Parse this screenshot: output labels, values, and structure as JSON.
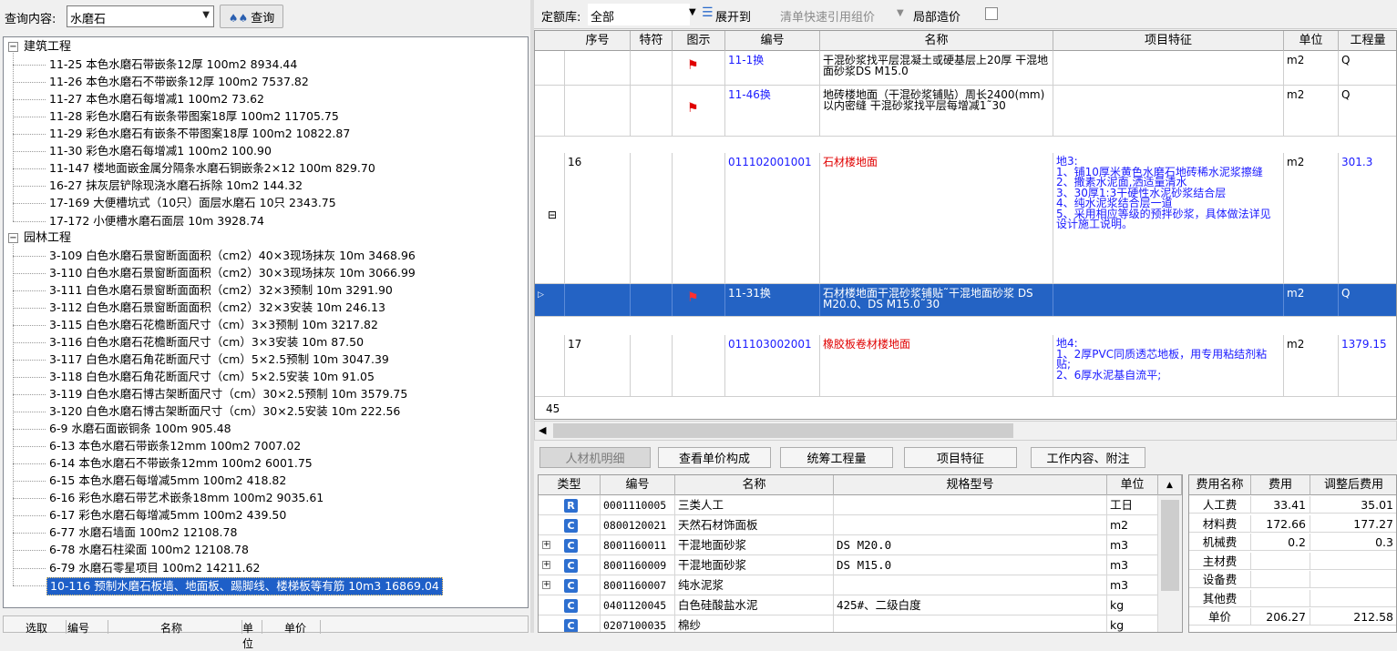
{
  "query": {
    "label": "查询内容:",
    "value": "水磨石",
    "button": "查询"
  },
  "tree": [
    {
      "label": "建筑工程",
      "toggle": "−",
      "children": [
        "11-25 本色水磨石带嵌条12厚 100m2 8934.44",
        "11-26 本色水磨石不带嵌条12厚 100m2 7537.82",
        "11-27 本色水磨石每增减1 100m2 73.62",
        "11-28 彩色水磨石有嵌条带图案18厚 100m2 11705.75",
        "11-29 彩色水磨石有嵌条不带图案18厚 100m2 10822.87",
        "11-30 彩色水磨石每增减1 100m2 100.90",
        "11-147 楼地面嵌金属分隔条水磨石铜嵌条2×12 100m 829.70",
        "16-27 抹灰层铲除现浇水磨石拆除 10m2 144.32",
        "17-169 大便槽坑式（10只）面层水磨石 10只 2343.75",
        "17-172 小便槽水磨石面层 10m 3928.74"
      ]
    },
    {
      "label": "园林工程",
      "toggle": "−",
      "children": [
        "3-109 白色水磨石景窗断面面积（cm2）40×3现场抹灰 10m 3468.96",
        "3-110 白色水磨石景窗断面面积（cm2）30×3现场抹灰 10m 3066.99",
        "3-111 白色水磨石景窗断面面积（cm2）32×3预制 10m 3291.90",
        "3-112 白色水磨石景窗断面面积（cm2）32×3安装 10m 246.13",
        "3-115 白色水磨石花檐断面尺寸（cm）3×3预制 10m 3217.82",
        "3-116 白色水磨石花檐断面尺寸（cm）3×3安装 10m 87.50",
        "3-117 白色水磨石角花断面尺寸（cm）5×2.5预制 10m 3047.39",
        "3-118 白色水磨石角花断面尺寸（cm）5×2.5安装 10m 91.05",
        "3-119 白色水磨石博古架断面尺寸（cm）30×2.5预制 10m 3579.75",
        "3-120 白色水磨石博古架断面尺寸（cm）30×2.5安装 10m 222.56",
        "6-9 水磨石面嵌铜条 100m 905.48",
        "6-13 本色水磨石带嵌条12mm 100m2 7007.02",
        "6-14 本色水磨石不带嵌条12mm 100m2 6001.75",
        "6-15 本色水磨石每增减5mm 100m2 418.82",
        "6-16 彩色水磨石带艺术嵌条18mm 100m2 9035.61",
        "6-17 彩色水磨石每增减5mm 100m2 439.50",
        "6-77 水磨石墙面 100m2 12108.78",
        "6-78 水磨石柱梁面 100m2 12108.78",
        "6-79 水磨石零星项目 100m2 14211.62",
        "10-116 预制水磨石板墙、地面板、踢脚线、楼梯板等有筋 10m3 16869.04"
      ]
    }
  ],
  "left_bottom_header": [
    "选取",
    "编号",
    "名称",
    "单位",
    "单价"
  ],
  "toolbar": {
    "quota_label": "定额库:",
    "quota_value": "全部",
    "expand": "展开到",
    "quick_ref": "清单快速引用组价",
    "local_cost": "局部造价"
  },
  "grid": {
    "headers": [
      "序号",
      "特符",
      "图示",
      "编号",
      "名称",
      "项目特征",
      "单位",
      "工程量"
    ],
    "rows": [
      {
        "seq": "",
        "flag": true,
        "code": "11-1换",
        "name": "干混砂浆找平层混凝土或硬基层上20厚 干混地面砂浆DS M15.0",
        "feature": "",
        "unit": "m2",
        "qty": "Q",
        "kind": "sub"
      },
      {
        "seq": "",
        "flag": true,
        "code": "11-46换",
        "name": "地砖楼地面（干混砂浆铺贴）周长2400(mm)以内密缝 干混砂浆找平层每增减1˜30",
        "feature": "",
        "unit": "m2",
        "qty": "Q",
        "kind": "sub"
      },
      {
        "seq": "16",
        "flag": false,
        "code": "011102001001",
        "name": "石材楼地面",
        "feature": "地3:\n1、铺10厚米黄色水磨石地砖稀水泥浆擦缝\n2、撒素水泥面,洒适量清水\n3、30厚1:3干硬性水泥砂浆结合层\n4、纯水泥浆结合层一道\n5、采用相应等级的预拌砂浆，具体做法详见设计施工说明。",
        "unit": "m2",
        "qty": "301.3",
        "kind": "bill"
      },
      {
        "seq": "",
        "flag": true,
        "code": "11-31换",
        "name": "石材楼地面干混砂浆铺贴˜干混地面砂浆 DS M20.0、DS M15.0˜30",
        "feature": "",
        "unit": "m2",
        "qty": "Q",
        "kind": "sub"
      },
      {
        "seq": "17",
        "flag": false,
        "code": "011103002001",
        "name": "橡胶板卷材楼地面",
        "feature": "地4:\n1、2厚PVC同质透芯地板，用专用粘结剂粘贴;\n2、6厚水泥基自流平;",
        "unit": "m2",
        "qty": "1379.15",
        "kind": "bill"
      }
    ],
    "footer_count": "45"
  },
  "tabs": [
    "人材机明细",
    "查看单价构成",
    "统筹工程量",
    "项目特征",
    "工作内容、附注"
  ],
  "resources": {
    "headers": [
      "类型",
      "编号",
      "名称",
      "规格型号",
      "单位"
    ],
    "rows": [
      {
        "type": "R",
        "code": "0001110005",
        "name": "三类人工",
        "spec": "",
        "unit": "工日",
        "expand": false
      },
      {
        "type": "C",
        "code": "0800120021",
        "name": "天然石材饰面板",
        "spec": "",
        "unit": "m2",
        "expand": false
      },
      {
        "type": "C",
        "code": "8001160011",
        "name": "干混地面砂浆",
        "spec": "DS M20.0",
        "unit": "m3",
        "expand": true
      },
      {
        "type": "C",
        "code": "8001160009",
        "name": "干混地面砂浆",
        "spec": "DS M15.0",
        "unit": "m3",
        "expand": true
      },
      {
        "type": "C",
        "code": "8001160007",
        "name": "纯水泥浆",
        "spec": "",
        "unit": "m3",
        "expand": true
      },
      {
        "type": "C",
        "code": "0401120045",
        "name": "白色硅酸盐水泥",
        "spec": "425#、二级白度",
        "unit": "kg",
        "expand": false
      },
      {
        "type": "C",
        "code": "0207100035",
        "name": "棉纱",
        "spec": "",
        "unit": "kg",
        "expand": false
      }
    ]
  },
  "fees": {
    "headers": [
      "费用名称",
      "费用",
      "调整后费用"
    ],
    "rows": [
      {
        "name": "人工费",
        "fee": "33.41",
        "adj": "35.01"
      },
      {
        "name": "材料费",
        "fee": "172.66",
        "adj": "177.27"
      },
      {
        "name": "机械费",
        "fee": "0.2",
        "adj": "0.3"
      },
      {
        "name": "主材费",
        "fee": "",
        "adj": ""
      },
      {
        "name": "设备费",
        "fee": "",
        "adj": ""
      },
      {
        "name": "其他费",
        "fee": "",
        "adj": ""
      },
      {
        "name": "单价",
        "fee": "206.27",
        "adj": "212.58"
      }
    ]
  }
}
